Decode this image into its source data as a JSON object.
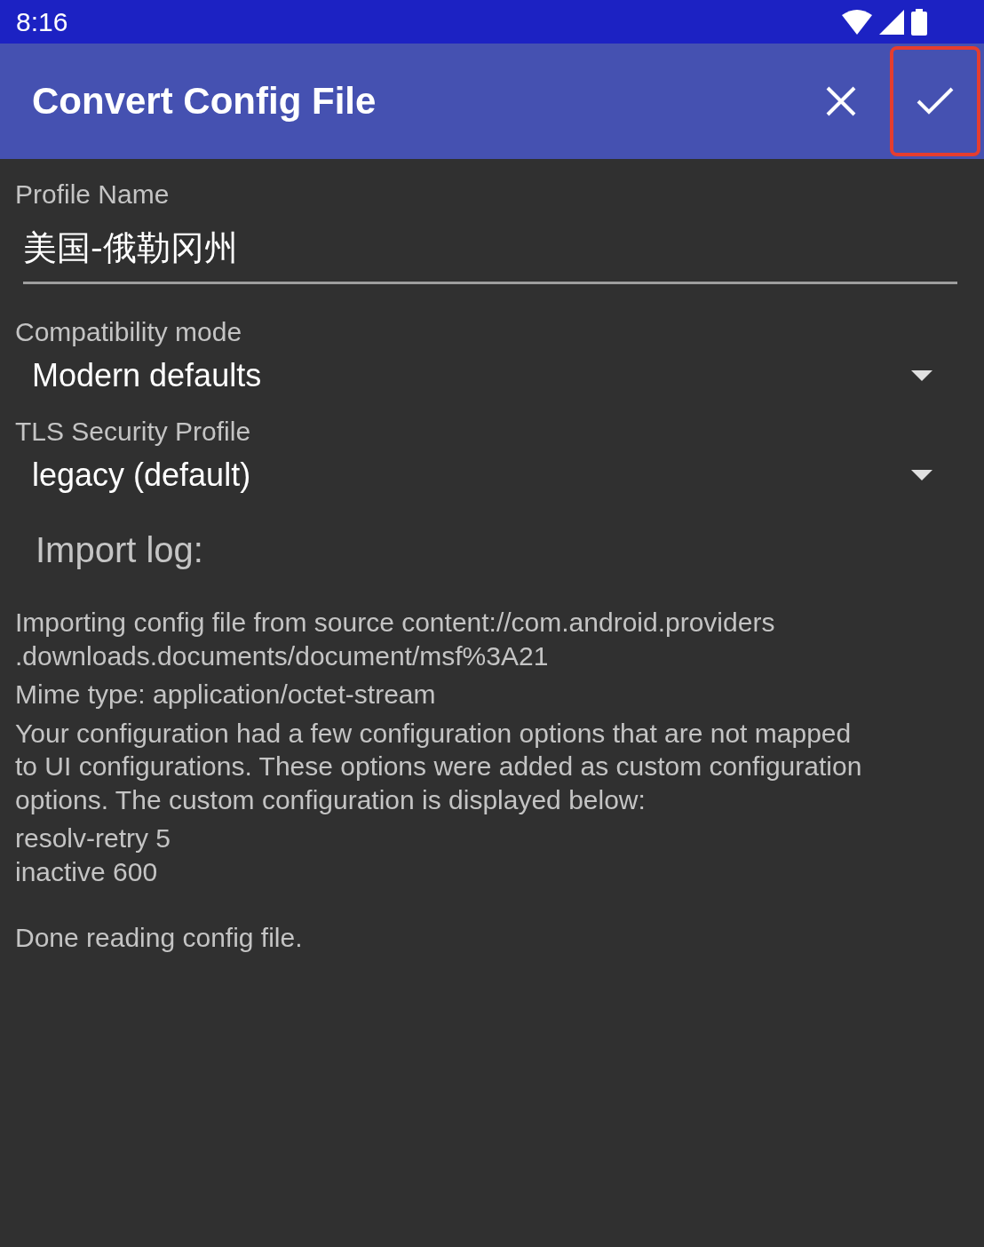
{
  "status_bar": {
    "time": "8:16"
  },
  "app_bar": {
    "title": "Convert Config File",
    "actions": [
      {
        "kind": "close",
        "highlighted": false
      },
      {
        "kind": "confirm",
        "highlighted": true
      }
    ]
  },
  "profile_name": {
    "label": "Profile Name",
    "value": "美国-俄勒冈州"
  },
  "dropdowns": [
    {
      "label": "Compatibility mode",
      "value": "Modern defaults"
    },
    {
      "label": "TLS Security Profile",
      "value": "legacy (default)"
    }
  ],
  "import_log": {
    "heading": "Import log:",
    "entries": [
      {
        "lines": [
          "Importing config file from source content://com.android.providers",
          ".downloads.documents/document/msf%3A21"
        ]
      },
      {
        "lines": [
          "Mime type: application/octet-stream"
        ]
      },
      {
        "lines": [
          "Your configuration had a few configuration options that are not mapped",
          "to UI configurations. These options were added as custom configuration",
          "options. The custom configuration is displayed below:"
        ]
      },
      {
        "lines": [
          "resolv-retry 5",
          "inactive 600"
        ]
      },
      {
        "lines": [
          "Done reading config file."
        ],
        "spaced": true
      }
    ]
  }
}
